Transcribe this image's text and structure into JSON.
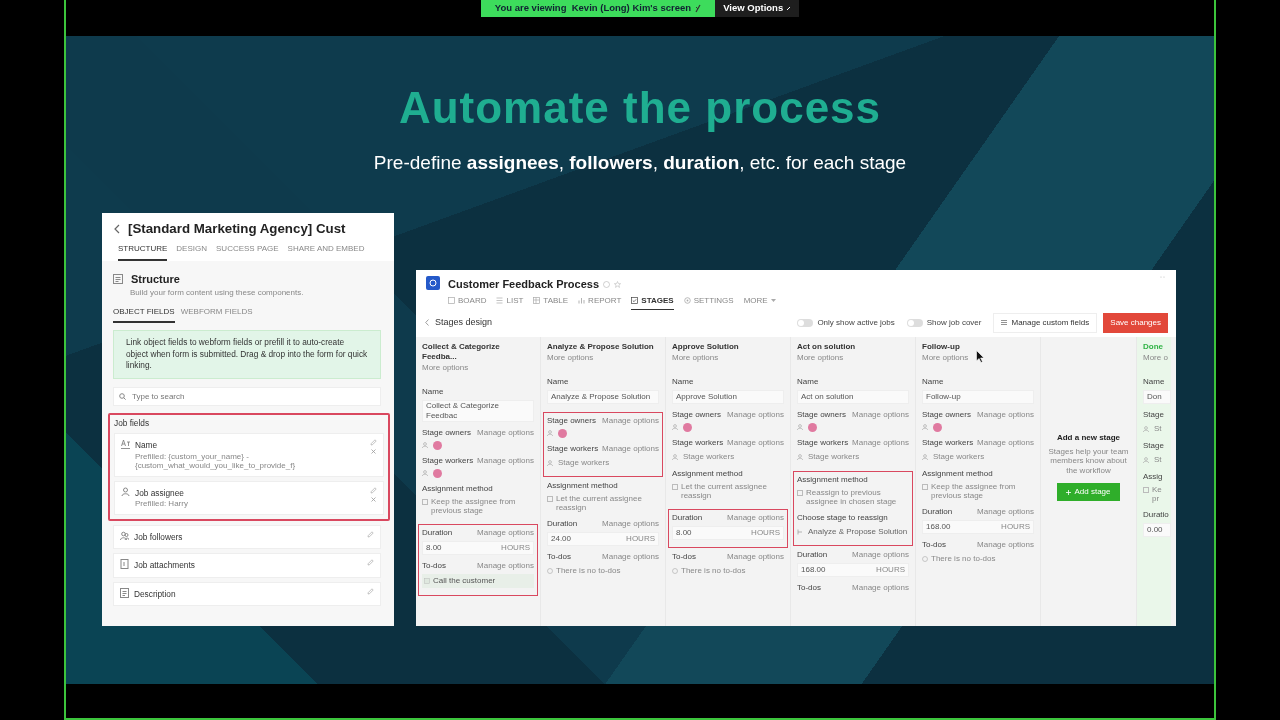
{
  "share_banner": {
    "text": "You are viewing  Kevin (Long) Kim's screen",
    "button": "View Options"
  },
  "slide": {
    "title": "Automate the process",
    "subtitle": "Pre-define **assignees**, **followers**, **duration**, etc. for each stage"
  },
  "form_panel": {
    "title": "[Standard Marketing Agency] Cust",
    "tabs": [
      {
        "label": "STRUCTURE",
        "selected": true
      },
      {
        "label": "DESIGN",
        "selected": false
      },
      {
        "label": "SUCCESS PAGE",
        "selected": false
      },
      {
        "label": "SHARE AND EMBED",
        "selected": false
      }
    ],
    "section_title": "Structure",
    "section_hint": "Build your form content using these components.",
    "subtabs": [
      {
        "label": "OBJECT FIELDS",
        "selected": true
      },
      {
        "label": "WEBFORM FIELDS",
        "selected": false
      }
    ],
    "info": "Link object fields to webform fields or prefill it to auto-create object when form is submitted. Drag & drop into the form for quick linking.",
    "search": {
      "placeholder": "Type to search"
    },
    "group": {
      "title": "Job fields",
      "highlighted": true,
      "fields": [
        {
          "kind": "text",
          "label": "Name",
          "hint": "Prefilled: {custom_your_name} - {custom_what_would_you_like_to_provide_f}"
        },
        {
          "kind": "person",
          "label": "Job assignee",
          "hint": "Prefilled: Harry"
        }
      ]
    },
    "fields": [
      {
        "kind": "people",
        "label": "Job followers"
      },
      {
        "kind": "attachment",
        "label": "Job attachments"
      },
      {
        "kind": "description",
        "label": "Description"
      }
    ]
  },
  "process_panel": {
    "title": "Customer Feedback Process",
    "tabs": [
      {
        "kind": "board",
        "label": "BOARD",
        "selected": false
      },
      {
        "kind": "list",
        "label": "LIST",
        "selected": false
      },
      {
        "kind": "table",
        "label": "TABLE",
        "selected": false
      },
      {
        "kind": "report",
        "label": "REPORT",
        "selected": false
      },
      {
        "kind": "stages",
        "label": "STAGES",
        "selected": true
      },
      {
        "kind": "settings",
        "label": "SETTINGS",
        "selected": false
      },
      {
        "kind": "more",
        "label": "MORE",
        "selected": false
      }
    ],
    "page_title": "Stages design",
    "toggles": [
      {
        "label": "Only show active jobs",
        "on": false
      },
      {
        "label": "Show job cover",
        "on": false
      }
    ],
    "manage_button": "Manage custom fields",
    "save_button": "Save changes",
    "stages": [
      {
        "title": "Collect & Categorize Feedba...",
        "more": "More options",
        "blocks": [
          {
            "highlighted": false,
            "sections": [
              {
                "kind": "name",
                "label": "Name",
                "value": "Collect & Categorize Feedbac"
              },
              {
                "kind": "people",
                "label": "Stage owners",
                "action": "Manage options"
              },
              {
                "kind": "people",
                "label": "Stage workers",
                "action": "Manage options"
              },
              {
                "kind": "checkbox",
                "label": "Assignment method",
                "option": "Keep the assignee from previous stage",
                "checked": false
              }
            ]
          },
          {
            "highlighted": true,
            "sections": [
              {
                "kind": "duration",
                "label": "Duration",
                "action": "Manage options",
                "value": "8.00",
                "unit": "HOURS"
              },
              {
                "kind": "todos",
                "label": "To-dos",
                "action": "Manage options",
                "items": [
                  "Call the customer"
                ]
              }
            ]
          }
        ]
      },
      {
        "title": "Analyze & Propose Solution",
        "more": "More options",
        "blocks": [
          {
            "highlighted": false,
            "sections": [
              {
                "kind": "name",
                "label": "Name",
                "value": "Analyze & Propose Solution"
              }
            ]
          },
          {
            "highlighted": true,
            "sections": [
              {
                "kind": "people",
                "label": "Stage owners",
                "action": "Manage options"
              },
              {
                "kind": "people",
                "label": "Stage workers",
                "action": "Manage options",
                "placeholder": "Stage workers"
              }
            ]
          },
          {
            "highlighted": false,
            "sections": [
              {
                "kind": "checkbox",
                "label": "Assignment method",
                "option": "Let the current assignee reassign",
                "checked": false
              },
              {
                "kind": "duration",
                "label": "Duration",
                "action": "Manage options",
                "value": "24.00",
                "unit": "HOURS"
              },
              {
                "kind": "todos",
                "label": "To-dos",
                "action": "Manage options",
                "empty": "There is no to-dos"
              }
            ]
          }
        ]
      },
      {
        "title": "Approve Solution",
        "more": "More options",
        "blocks": [
          {
            "highlighted": false,
            "sections": [
              {
                "kind": "name",
                "label": "Name",
                "value": "Approve Solution"
              },
              {
                "kind": "people",
                "label": "Stage owners",
                "action": "Manage options"
              },
              {
                "kind": "people",
                "label": "Stage workers",
                "action": "Manage options",
                "placeholder": "Stage workers"
              },
              {
                "kind": "checkbox",
                "label": "Assignment method",
                "option": "Let the current assignee reassign",
                "checked": false
              }
            ]
          },
          {
            "highlighted": true,
            "sections": [
              {
                "kind": "duration",
                "label": "Duration",
                "action": "Manage options",
                "value": "8.00",
                "unit": "HOURS"
              }
            ]
          },
          {
            "highlighted": false,
            "sections": [
              {
                "kind": "todos",
                "label": "To-dos",
                "action": "Manage options",
                "empty": "There is no to-dos"
              }
            ]
          }
        ]
      },
      {
        "title": "Act on solution",
        "more": "More options",
        "blocks": [
          {
            "highlighted": false,
            "sections": [
              {
                "kind": "name",
                "label": "Name",
                "value": "Act on solution"
              },
              {
                "kind": "people",
                "label": "Stage owners",
                "action": "Manage options"
              },
              {
                "kind": "people",
                "label": "Stage workers",
                "action": "Manage options",
                "placeholder": "Stage workers"
              }
            ]
          },
          {
            "highlighted": true,
            "sections": [
              {
                "kind": "checkbox",
                "label": "Assignment method",
                "option": "Reassign to previous assignee in chosen stage",
                "checked": false
              },
              {
                "kind": "select",
                "label": "Choose stage to reassign",
                "value": "Analyze & Propose Solution"
              }
            ]
          },
          {
            "highlighted": false,
            "sections": [
              {
                "kind": "duration",
                "label": "Duration",
                "action": "Manage options",
                "value": "168.00",
                "unit": "HOURS"
              },
              {
                "kind": "todos",
                "label": "To-dos",
                "action": "Manage options"
              }
            ]
          }
        ]
      },
      {
        "title": "Follow-up",
        "more": "More options",
        "blocks": [
          {
            "highlighted": false,
            "sections": [
              {
                "kind": "name",
                "label": "Name",
                "value": "Follow-up"
              },
              {
                "kind": "people",
                "label": "Stage owners",
                "action": "Manage options"
              },
              {
                "kind": "people",
                "label": "Stage workers",
                "action": "Manage options",
                "placeholder": "Stage workers"
              },
              {
                "kind": "checkbox",
                "label": "Assignment method",
                "option": "Keep the assignee from previous stage",
                "checked": false
              },
              {
                "kind": "duration",
                "label": "Duration",
                "action": "Manage options",
                "value": "168.00",
                "unit": "HOURS"
              },
              {
                "kind": "todos",
                "label": "To-dos",
                "action": "Manage options",
                "empty": "There is no to-dos"
              }
            ]
          }
        ]
      }
    ],
    "add_stage": {
      "title": "Add a new stage",
      "hint": "Stages help your team members know about the workflow",
      "button": "Add stage"
    },
    "cut_stage": {
      "title": "Done",
      "color": "#2fb344",
      "more": "More o",
      "blocks": [
        {
          "highlighted": false,
          "sections": [
            {
              "kind": "name",
              "label": "Name",
              "value": "Don"
            },
            {
              "kind": "people",
              "label": "Stage",
              "placeholder": "St"
            },
            {
              "kind": "people",
              "label": "Stage",
              "placeholder": "St"
            },
            {
              "kind": "checkbox",
              "label": "Assig",
              "option": "Ke pr",
              "checked": false
            },
            {
              "kind": "duration",
              "label": "Duratio",
              "value": "0.00"
            }
          ]
        }
      ]
    }
  }
}
